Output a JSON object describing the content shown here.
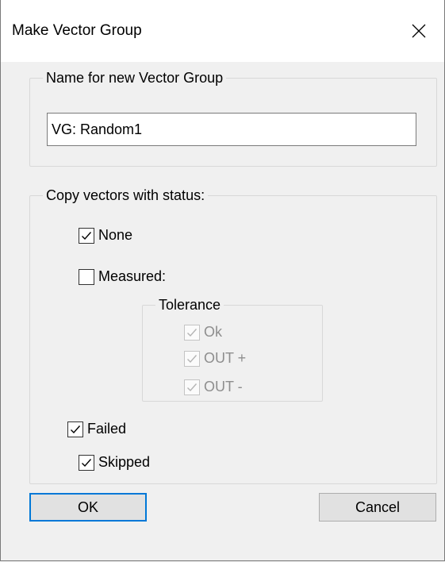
{
  "window": {
    "title": "Make Vector Group",
    "close_icon": "close-icon"
  },
  "name_group": {
    "legend": "Name for new Vector Group",
    "value": "VG: Random1"
  },
  "status_group": {
    "legend": "Copy vectors with status:",
    "none": {
      "label": "None",
      "checked": true
    },
    "measured": {
      "label": "Measured:",
      "checked": false
    },
    "tolerance": {
      "legend": "Tolerance",
      "items": [
        {
          "label": "Ok",
          "checked": true,
          "disabled": true
        },
        {
          "label": "OUT +",
          "checked": true,
          "disabled": true
        },
        {
          "label": "OUT -",
          "checked": true,
          "disabled": true
        }
      ]
    },
    "failed": {
      "label": "Failed",
      "checked": true
    },
    "skipped": {
      "label": "Skipped",
      "checked": true
    }
  },
  "buttons": {
    "ok_label": "OK",
    "cancel_label": "Cancel"
  },
  "colors": {
    "accent": "#0078d7",
    "dialog_bg": "#f0f0f0",
    "disabled_text": "#8e8e8e"
  }
}
